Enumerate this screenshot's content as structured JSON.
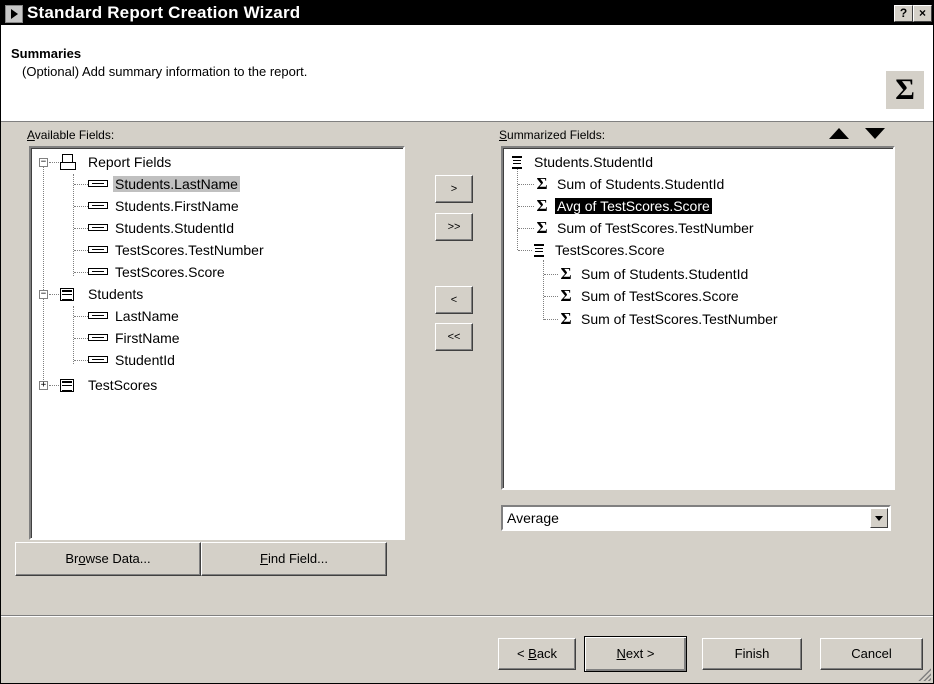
{
  "window": {
    "title": "Standard Report Creation Wizard",
    "help_label": "?",
    "close_label": "×"
  },
  "header": {
    "title": "Summaries",
    "subtitle": "(Optional) Add summary information to the report.",
    "icon": "sigma-icon"
  },
  "available": {
    "label_pre": "",
    "label_u": "A",
    "label_post": "vailable Fields:",
    "nodes": [
      {
        "label": "Report Fields",
        "icon": "report-icon",
        "expander": "−"
      },
      {
        "label": "Students.LastName",
        "icon": "field-icon",
        "selected": true
      },
      {
        "label": "Students.FirstName",
        "icon": "field-icon"
      },
      {
        "label": "Students.StudentId",
        "icon": "field-icon"
      },
      {
        "label": "TestScores.TestNumber",
        "icon": "field-icon"
      },
      {
        "label": "TestScores.Score",
        "icon": "field-icon"
      },
      {
        "label": "Students",
        "icon": "table-icon",
        "expander": "−"
      },
      {
        "label": "LastName",
        "icon": "field-icon"
      },
      {
        "label": "FirstName",
        "icon": "field-icon"
      },
      {
        "label": "StudentId",
        "icon": "field-icon"
      },
      {
        "label": "TestScores",
        "icon": "table-icon",
        "expander": "+"
      }
    ]
  },
  "move_buttons": {
    "add": ">",
    "add_all": ">>",
    "remove": "<",
    "remove_all": "<<"
  },
  "summarized": {
    "label_pre": "",
    "label_u": "S",
    "label_post": "ummarized Fields:",
    "nodes": [
      {
        "label": "Students.StudentId",
        "icon": "group-icon"
      },
      {
        "label": "Sum of Students.StudentId",
        "icon": "sigma-icon"
      },
      {
        "label": "Avg of TestScores.Score",
        "icon": "sigma-icon",
        "selected": true
      },
      {
        "label": "Sum of TestScores.TestNumber",
        "icon": "sigma-icon"
      },
      {
        "label": "TestScores.Score",
        "icon": "group-icon"
      },
      {
        "label": "Sum of Students.StudentId",
        "icon": "sigma-icon"
      },
      {
        "label": "Sum of TestScores.Score",
        "icon": "sigma-icon"
      },
      {
        "label": "Sum of TestScores.TestNumber",
        "icon": "sigma-icon"
      }
    ]
  },
  "summary_type": {
    "value": "Average"
  },
  "browse": {
    "pre": "Br",
    "u": "o",
    "post": "wse Data..."
  },
  "find": {
    "pre": "",
    "u": "F",
    "post": "ind Field..."
  },
  "nav": {
    "back": {
      "pre": "< ",
      "u": "B",
      "post": "ack"
    },
    "next": {
      "pre": "",
      "u": "N",
      "post": "ext >"
    },
    "finish": "Finish",
    "cancel": "Cancel"
  }
}
